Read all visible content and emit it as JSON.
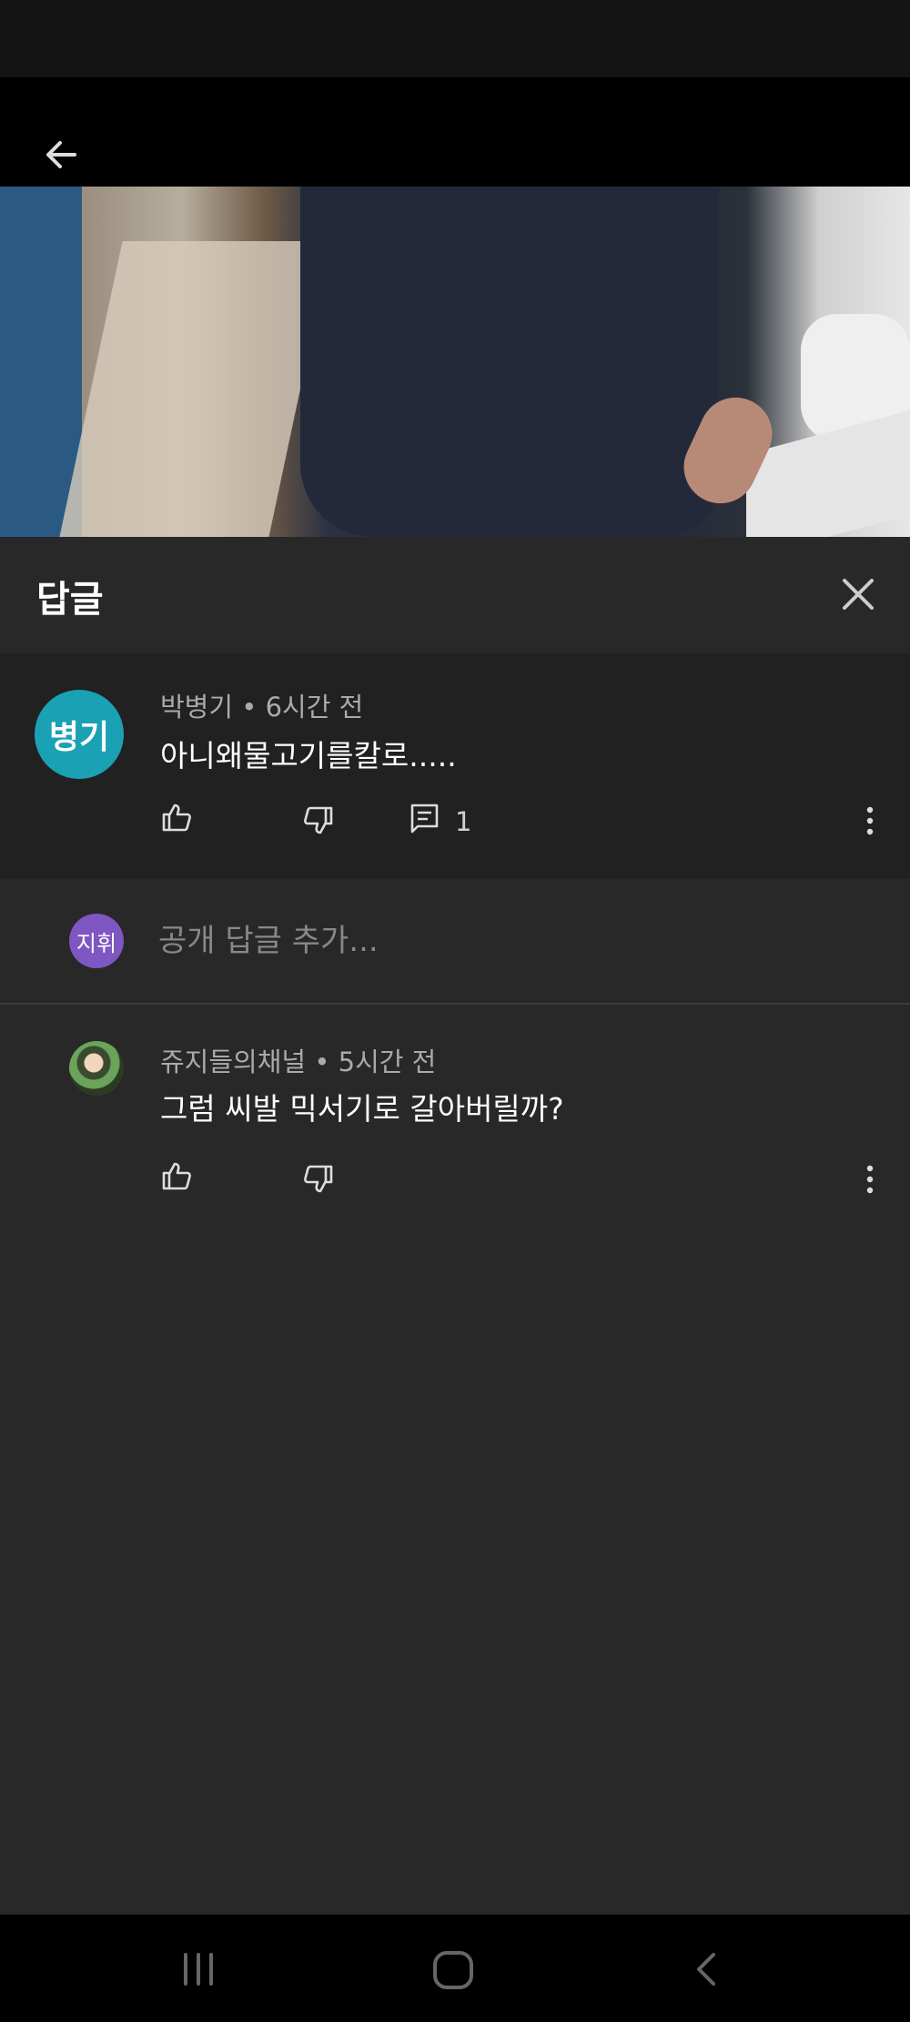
{
  "panel": {
    "title": "답글"
  },
  "main_comment": {
    "avatar_text": "병기",
    "author": "박병기",
    "separator": "•",
    "time": "6시간 전",
    "text": "아니왜물고기를칼로.....",
    "reply_count": "1"
  },
  "reply_box": {
    "avatar_text": "지휘",
    "placeholder": "공개 답글 추가..."
  },
  "replies": [
    {
      "author": "쥬지들의채널",
      "separator": "•",
      "time": "5시간 전",
      "text": "그럼 씨발 믹서기로 갈아버릴까?"
    }
  ],
  "icons": [
    "back-arrow-icon",
    "close-icon",
    "thumbs-up-icon",
    "thumbs-down-icon",
    "comment-icon",
    "more-vert-icon",
    "recent-apps-icon",
    "home-icon",
    "back-icon"
  ],
  "colors": {
    "background": "#282828",
    "comment_bg": "#212121",
    "avatar_primary": "#1aa1b3",
    "avatar_user": "#7e57c2"
  }
}
